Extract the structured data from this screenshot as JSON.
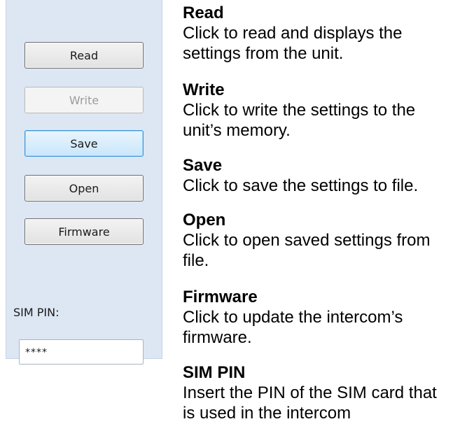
{
  "panel": {
    "buttons": {
      "read": "Read",
      "write": "Write",
      "save": "Save",
      "open": "Open",
      "firmware": "Firmware"
    },
    "sim_pin_label": "SIM PIN:",
    "sim_pin_value": "****"
  },
  "descriptions": [
    {
      "title": "Read",
      "lines": [
        "Click to read and displays the",
        "settings from the unit."
      ]
    },
    {
      "title": "Write",
      "lines": [
        "Click to write the settings to the",
        "unit’s memory."
      ]
    },
    {
      "title": "Save",
      "lines": [
        "Click to save the settings to file."
      ]
    },
    {
      "title": "Open",
      "lines": [
        "Click to open saved settings from",
        "file."
      ]
    },
    {
      "title": "Firmware",
      "lines": [
        "Click to update the intercom’s",
        "firmware."
      ]
    },
    {
      "title": "SIM PIN",
      "lines": [
        "Insert the PIN of the SIM card that",
        "is used in the intercom"
      ]
    }
  ]
}
